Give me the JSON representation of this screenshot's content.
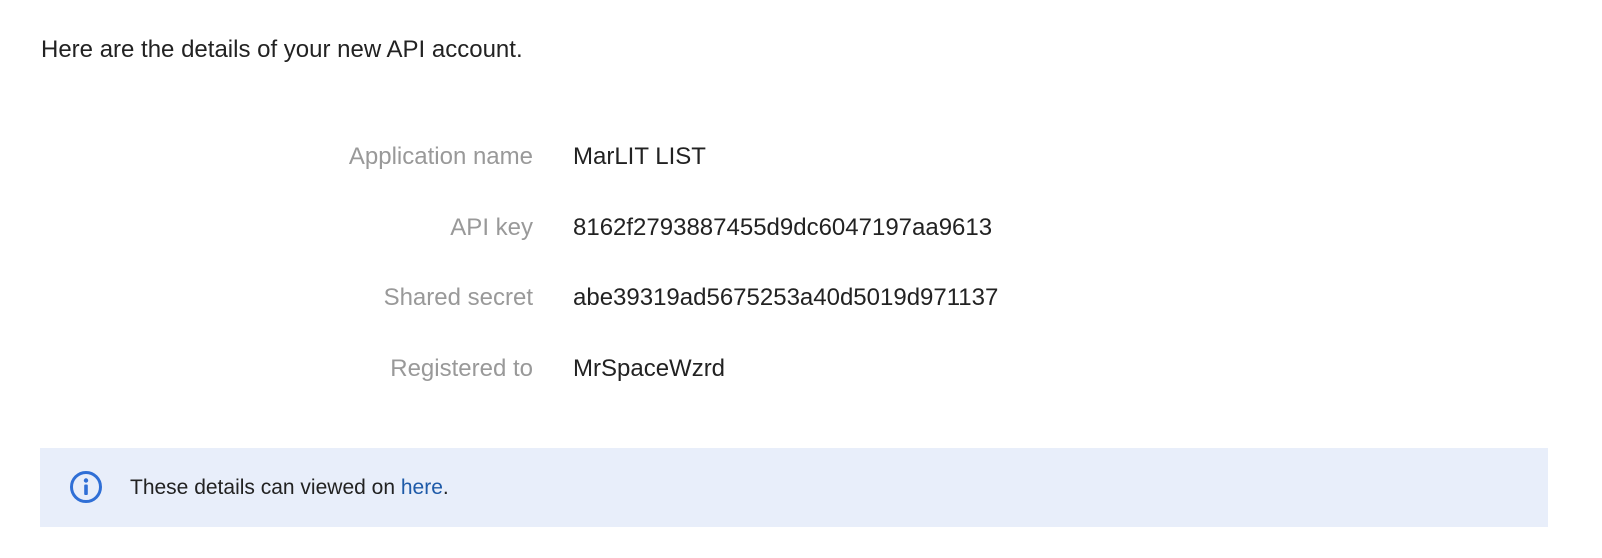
{
  "intro": "Here are the details of your new API account.",
  "details": [
    {
      "label": "Application name",
      "value": "MarLIT LIST"
    },
    {
      "label": "API key",
      "value": "8162f2793887455d9dc6047197aa9613"
    },
    {
      "label": "Shared secret",
      "value": "abe39319ad5675253a40d5019d971137"
    },
    {
      "label": "Registered to",
      "value": "MrSpaceWzrd"
    }
  ],
  "notice": {
    "icon": "info-icon",
    "text_before": "These details can viewed on ",
    "link_text": "here",
    "text_after": ".",
    "background": "#e8eefa",
    "icon_color": "#2f6fd6",
    "link_color": "#1e5aa8"
  }
}
